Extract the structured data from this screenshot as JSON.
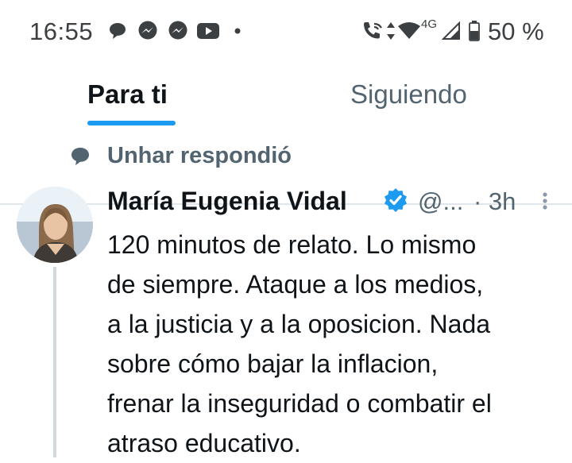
{
  "status_bar": {
    "time": "16:55",
    "battery": "50 %",
    "network": "4G",
    "notification_icons": [
      "chat-bubble-icon",
      "messenger-icon",
      "messenger-icon",
      "youtube-icon",
      "dot-icon"
    ],
    "system_icons": [
      "wifi-call-icon",
      "data-arrows-icon",
      "wifi-icon",
      "signal-icon",
      "battery-icon"
    ]
  },
  "tabs": [
    {
      "label": "Para ti",
      "active": true
    },
    {
      "label": "Siguiendo",
      "active": false
    }
  ],
  "post": {
    "context": "Unhar respondió",
    "author_name": "María Eugenia Vidal",
    "handle": "@...",
    "time_ago": "· 3h",
    "text_lines": [
      "120 minutos de relato. Lo mismo",
      "de siempre. Ataque a los medios,",
      "a la justicia y a la oposicion. Nada",
      "sobre cómo bajar la inflacion,",
      "frenar la inseguridad o combatir el",
      "atraso educativo."
    ]
  },
  "colors": {
    "accent": "#1d9bf0",
    "secondary_text": "#536471",
    "primary_text": "#0f1419"
  }
}
